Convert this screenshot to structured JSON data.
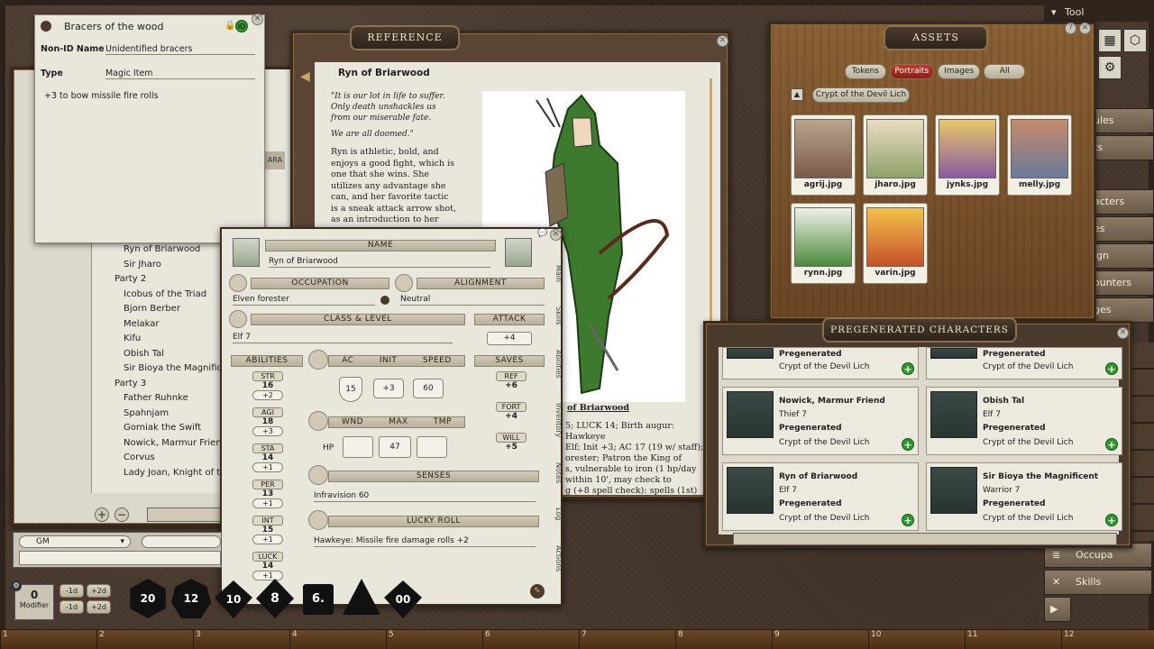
{
  "tool_label": "Tool",
  "bracers": {
    "title": "Bracers of the wood",
    "nonid_label": "Non-ID Name",
    "nonid_value": "Unidentified bracers",
    "type_label": "Type",
    "type_value": "Magic Item",
    "desc": "+3 to bow missile fire rolls"
  },
  "reference": {
    "title": "REFERENCE",
    "page_title": "Ryn of Briarwood",
    "quote1": "\"It is our lot in life to suffer. Only death unshackles us from our miserable fate.",
    "quote2": "We are all doomed.\"",
    "body": "Ryn is athletic, bold, and enjoys a good fight, which is one that she wins. She utilizes any advantage she can, and her favorite tactic is a sneak attack arrow shot, as an introduction to her foes.",
    "caption": "of Briarwood",
    "stats_lines": [
      "5; LUCK 14; Birth augur: Hawkeye",
      "Elf; Init +3; AC 17 (19 w/ staff);",
      "orester; Patron the King of",
      "s, vulnerable to iron (1 hp/day",
      "within 10', may check to",
      "g (+8 spell check): spells (1st)"
    ],
    "side_stub": "ARA"
  },
  "party_list": {
    "items": [
      "Ryn of Briarwood",
      "Sir Jharo",
      "Party 2",
      "Icobus of the Triad",
      "Bjorn Berber",
      "Melakar",
      "Kifu",
      "Obish Tal",
      "Sir Bioya the Magnificent",
      "Party 3",
      "Father Ruhnke",
      "Spahnjam",
      "Gorniak the Swift",
      "Nowick, Marmur Friend",
      "Corvus",
      "Lady Joan, Knight of the O"
    ]
  },
  "sheet": {
    "name_label": "NAME",
    "name_value": "Ryn of Briarwood",
    "occupation_label": "OCCUPATION",
    "occupation_value": "Elven forester",
    "alignment_label": "ALIGNMENT",
    "alignment_value": "Neutral",
    "class_label": "CLASS & LEVEL",
    "class_value": "Elf 7",
    "attack_label": "ATTACK",
    "attack_value": "+4",
    "abilities_label": "ABILITIES",
    "ac_label": "AC",
    "init_label": "INIT",
    "speed_label": "SPEED",
    "saves_label": "SAVES",
    "ac_value": "15",
    "init_value": "+3",
    "speed_value": "60",
    "abilities": [
      {
        "name": "STR",
        "value": "16",
        "mod": "+2"
      },
      {
        "name": "AGI",
        "value": "18",
        "mod": "+3"
      },
      {
        "name": "STA",
        "value": "14",
        "mod": "+1"
      },
      {
        "name": "PER",
        "value": "13",
        "mod": "+1"
      },
      {
        "name": "INT",
        "value": "15",
        "mod": "+1"
      },
      {
        "name": "LUCK",
        "value": "14",
        "mod": "+1"
      }
    ],
    "saves": [
      {
        "name": "REF",
        "value": "+6"
      },
      {
        "name": "FORT",
        "value": "+4"
      },
      {
        "name": "WILL",
        "value": "+5"
      }
    ],
    "wnd_label": "WND",
    "max_label": "MAX",
    "tmp_label": "TMP",
    "hp_label": "HP",
    "hp_max": "47",
    "senses_label": "SENSES",
    "senses_value": "Infravision 60",
    "lucky_label": "LUCKY ROLL",
    "lucky_value": "Hawkeye: Missile fire damage rolls +2",
    "tabs": [
      "Main",
      "Skills",
      "Abilities",
      "Inventory",
      "Notes",
      "Log",
      "Actions"
    ]
  },
  "assets": {
    "title": "ASSETS",
    "filters": [
      "Tokens",
      "Portraits",
      "Images",
      "All"
    ],
    "active_filter": "Portraits",
    "folder": "Crypt of the Devil Lich",
    "files": [
      "agrij.jpg",
      "jharo.jpg",
      "jynks.jpg",
      "melly.jpg",
      "rynn.jpg",
      "varin.jpg"
    ]
  },
  "pregen": {
    "title": "PREGENERATED CHARACTERS",
    "top_row": [
      {
        "tag": "Pregenerated",
        "module": "Crypt of the Devil Lich"
      },
      {
        "tag": "Pregenerated",
        "module": "Crypt of the Devil Lich"
      }
    ],
    "cards": [
      {
        "name": "Nowick, Marmur Friend",
        "cls": "Thief 7",
        "tag": "Pregenerated",
        "module": "Crypt of the Devil Lich"
      },
      {
        "name": "Obish Tal",
        "cls": "Elf 7",
        "tag": "Pregenerated",
        "module": "Crypt of the Devil Lich"
      },
      {
        "name": "Ryn of Briarwood",
        "cls": "Elf 7",
        "tag": "Pregenerated",
        "module": "Crypt of the Devil Lich"
      },
      {
        "name": "Sir Bioya the Magnificent",
        "cls": "Warrior 7",
        "tag": "Pregenerated",
        "module": "Crypt of the Devil Lich"
      }
    ]
  },
  "sidebar": {
    "partial": [
      "ules",
      "ts",
      "acters",
      "es",
      "ign",
      "ounters",
      "ges"
    ],
    "occupation": "Occupa",
    "skills": "Skills"
  },
  "chat": {
    "identity": "GM"
  },
  "modifier": {
    "value": "0",
    "label": "Modifier",
    "buttons": [
      "-1d",
      "+2d",
      "-1d",
      "+2d"
    ]
  },
  "dice": [
    "20",
    "12",
    "10",
    "8",
    "6.",
    "",
    "00"
  ],
  "ruler": [
    "1",
    "2",
    "3",
    "4",
    "5",
    "6",
    "7",
    "8",
    "9",
    "10",
    "11",
    "12"
  ]
}
